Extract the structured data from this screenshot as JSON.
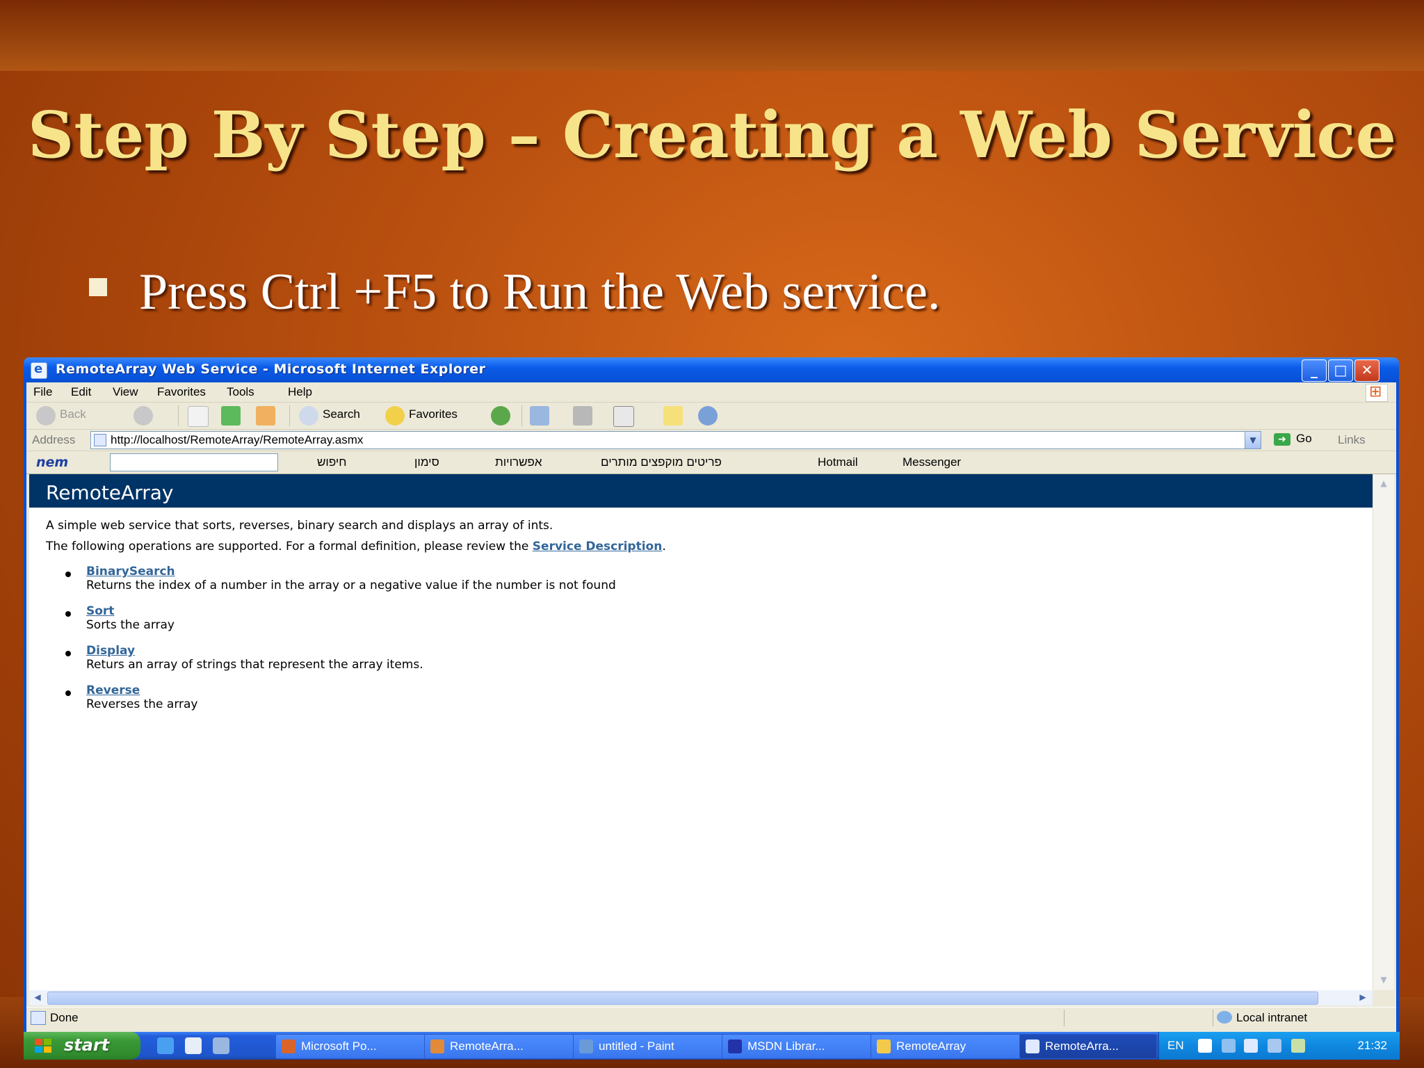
{
  "slide": {
    "title": "Step By Step – Creating a Web Service",
    "bullet": "Press Ctrl +F5 to Run the Web service."
  },
  "window": {
    "title": "RemoteArray Web Service - Microsoft Internet Explorer",
    "controls": {
      "minimize": "_",
      "maximize": "□",
      "close": "✕"
    }
  },
  "menu": [
    "File",
    "Edit",
    "View",
    "Favorites",
    "Tools",
    "Help"
  ],
  "toolbar": {
    "back": "Back",
    "search": "Search",
    "favorites": "Favorites"
  },
  "address": {
    "label": "Address",
    "url": "http://localhost/RemoteArray/RemoteArray.asmx",
    "go": "Go",
    "links": "Links"
  },
  "linksbar": {
    "brand": "nem",
    "items": [
      "חיפוש",
      "סימון",
      "אפשרויות",
      "פריטים מוקפצים מותרים",
      "Hotmail",
      "Messenger"
    ]
  },
  "page": {
    "heading": "RemoteArray",
    "intro": "A simple web service that sorts, reverses, binary search and displays an array of ints.",
    "supported_prefix": "The following operations are supported. For a formal definition, please review the",
    "service_description": "Service Description",
    "supported_suffix": ".",
    "operations": [
      {
        "name": "BinarySearch",
        "desc": "Returns the index of a number in the array or a negative value if the number is not found"
      },
      {
        "name": "Sort",
        "desc": "Sorts the array"
      },
      {
        "name": "Display",
        "desc": "Returs an array of strings that represent the array items."
      },
      {
        "name": "Reverse",
        "desc": "Reverses the array"
      }
    ]
  },
  "status": {
    "text": "Done",
    "zone": "Local intranet"
  },
  "taskbar": {
    "start": "start",
    "tasks": [
      {
        "label": "Microsoft Po...",
        "color": "#d9642a"
      },
      {
        "label": "RemoteArra...",
        "color": "#e08a3a"
      },
      {
        "label": "untitled - Paint",
        "color": "#6a9ad8"
      },
      {
        "label": "MSDN Librar...",
        "color": "#2233aa"
      },
      {
        "label": "RemoteArray",
        "color": "#f2c94a"
      },
      {
        "label": "RemoteArra...",
        "color": "#dfe9ff"
      }
    ],
    "lang": "EN",
    "clock": "21:32"
  }
}
